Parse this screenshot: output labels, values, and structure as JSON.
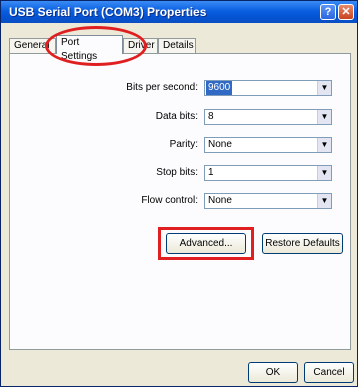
{
  "window": {
    "title": "USB Serial Port (COM3) Properties",
    "help_glyph": "?",
    "close_glyph": "✕"
  },
  "tabs": [
    {
      "label": "General"
    },
    {
      "label": "Port Settings",
      "active": true
    },
    {
      "label": "Driver"
    },
    {
      "label": "Details"
    }
  ],
  "fields": {
    "bits_per_second": {
      "label": "Bits per second:",
      "value": "9600"
    },
    "data_bits": {
      "label": "Data bits:",
      "value": "8"
    },
    "parity": {
      "label": "Parity:",
      "value": "None"
    },
    "stop_bits": {
      "label": "Stop bits:",
      "value": "1"
    },
    "flow_control": {
      "label": "Flow control:",
      "value": "None"
    }
  },
  "buttons": {
    "advanced": "Advanced...",
    "restore_defaults": "Restore Defaults",
    "ok": "OK",
    "cancel": "Cancel"
  },
  "annotation_color": "#e02020",
  "dropdown_arrow": "▼"
}
